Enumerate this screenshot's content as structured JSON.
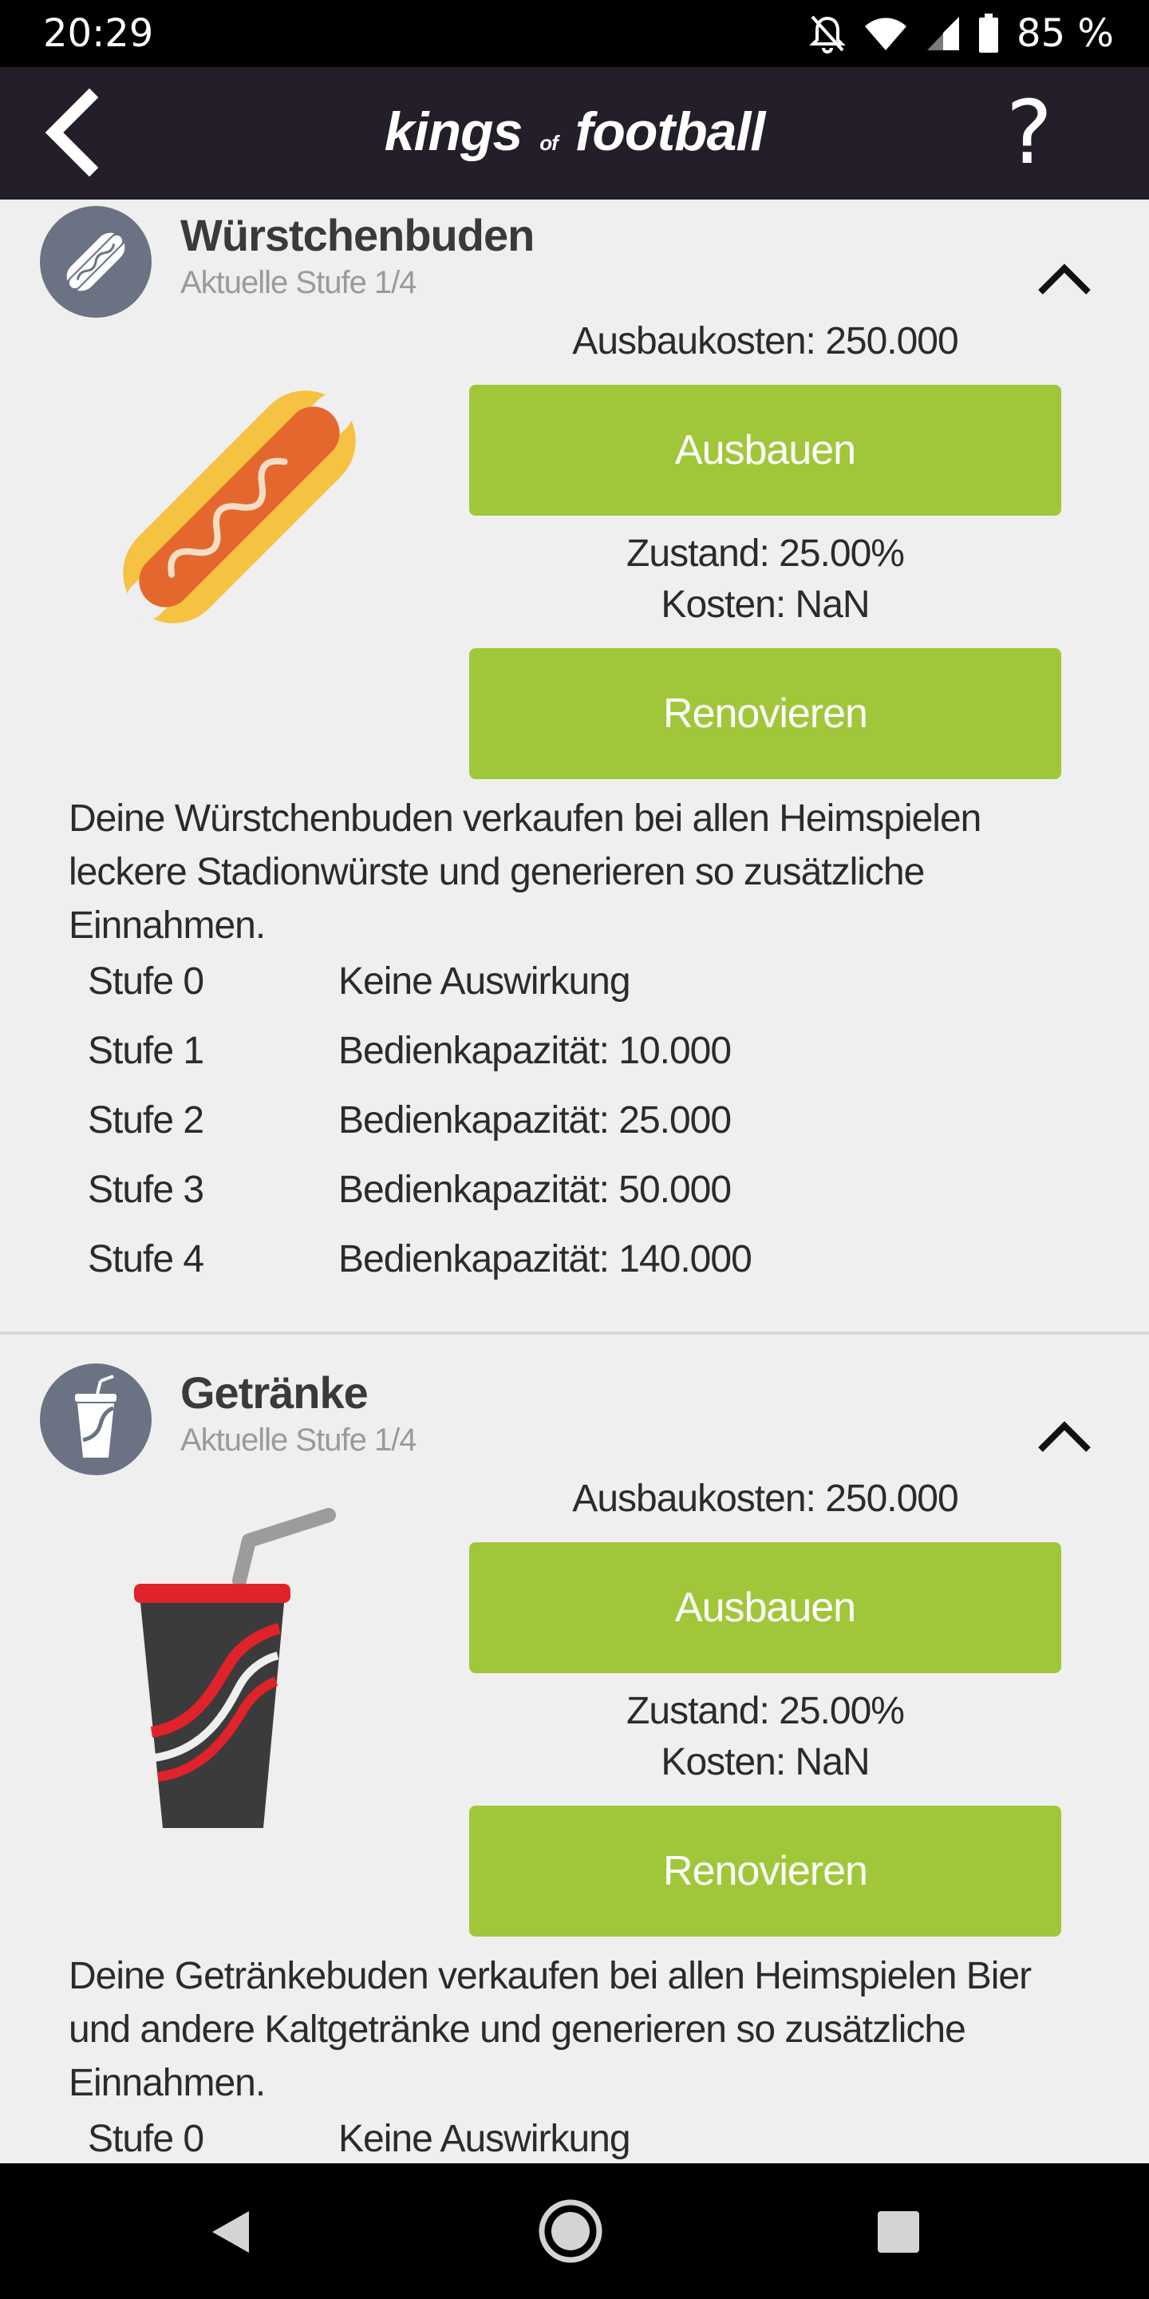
{
  "status_bar": {
    "time": "20:29",
    "battery_percent": "85 %",
    "icons": [
      "notifications-off-icon",
      "wifi-icon",
      "signal-icon",
      "battery-icon"
    ]
  },
  "header": {
    "logo_part1": "kings",
    "logo_part2": "of",
    "logo_part3": "football",
    "help_label": "?",
    "back_icon": "back-arrow-icon"
  },
  "colors": {
    "header_bg": "#231e2a",
    "button_green": "#a0c73a",
    "avatar_bg": "#6a7283",
    "page_bg": "#efefef"
  },
  "sections": [
    {
      "icon": "hotdog-icon",
      "title": "Würstchenbuden",
      "subtitle": "Aktuelle Stufe 1/4",
      "upgrade_cost": "Ausbaukosten: 250.000",
      "upgrade_button": "Ausbauen",
      "condition": "Zustand: 25.00%",
      "renovate_cost": "Kosten: NaN",
      "renovate_button": "Renovieren",
      "description": "Deine Würstchenbuden verkaufen bei allen Heimspielen leckere Stadionwürste und generieren so zusätzliche Einnahmen.",
      "levels": [
        {
          "name": "Stufe 0",
          "effect": "Keine Auswirkung"
        },
        {
          "name": "Stufe 1",
          "effect": "Bedienkapazität: 10.000"
        },
        {
          "name": "Stufe 2",
          "effect": "Bedienkapazität: 25.000"
        },
        {
          "name": "Stufe 3",
          "effect": "Bedienkapazität: 50.000"
        },
        {
          "name": "Stufe 4",
          "effect": "Bedienkapazität: 140.000"
        }
      ]
    },
    {
      "icon": "drink-cup-icon",
      "title": "Getränke",
      "subtitle": "Aktuelle Stufe 1/4",
      "upgrade_cost": "Ausbaukosten: 250.000",
      "upgrade_button": "Ausbauen",
      "condition": "Zustand: 25.00%",
      "renovate_cost": "Kosten: NaN",
      "renovate_button": "Renovieren",
      "description": "Deine Getränkebuden verkaufen bei allen Heimspielen Bier und andere Kaltgetränke und generieren so zusätzliche Einnahmen.",
      "levels": [
        {
          "name": "Stufe 0",
          "effect": "Keine Auswirkung"
        }
      ]
    }
  ],
  "nav_bar": {
    "icons": [
      "nav-back-icon",
      "nav-home-icon",
      "nav-recents-icon"
    ]
  }
}
